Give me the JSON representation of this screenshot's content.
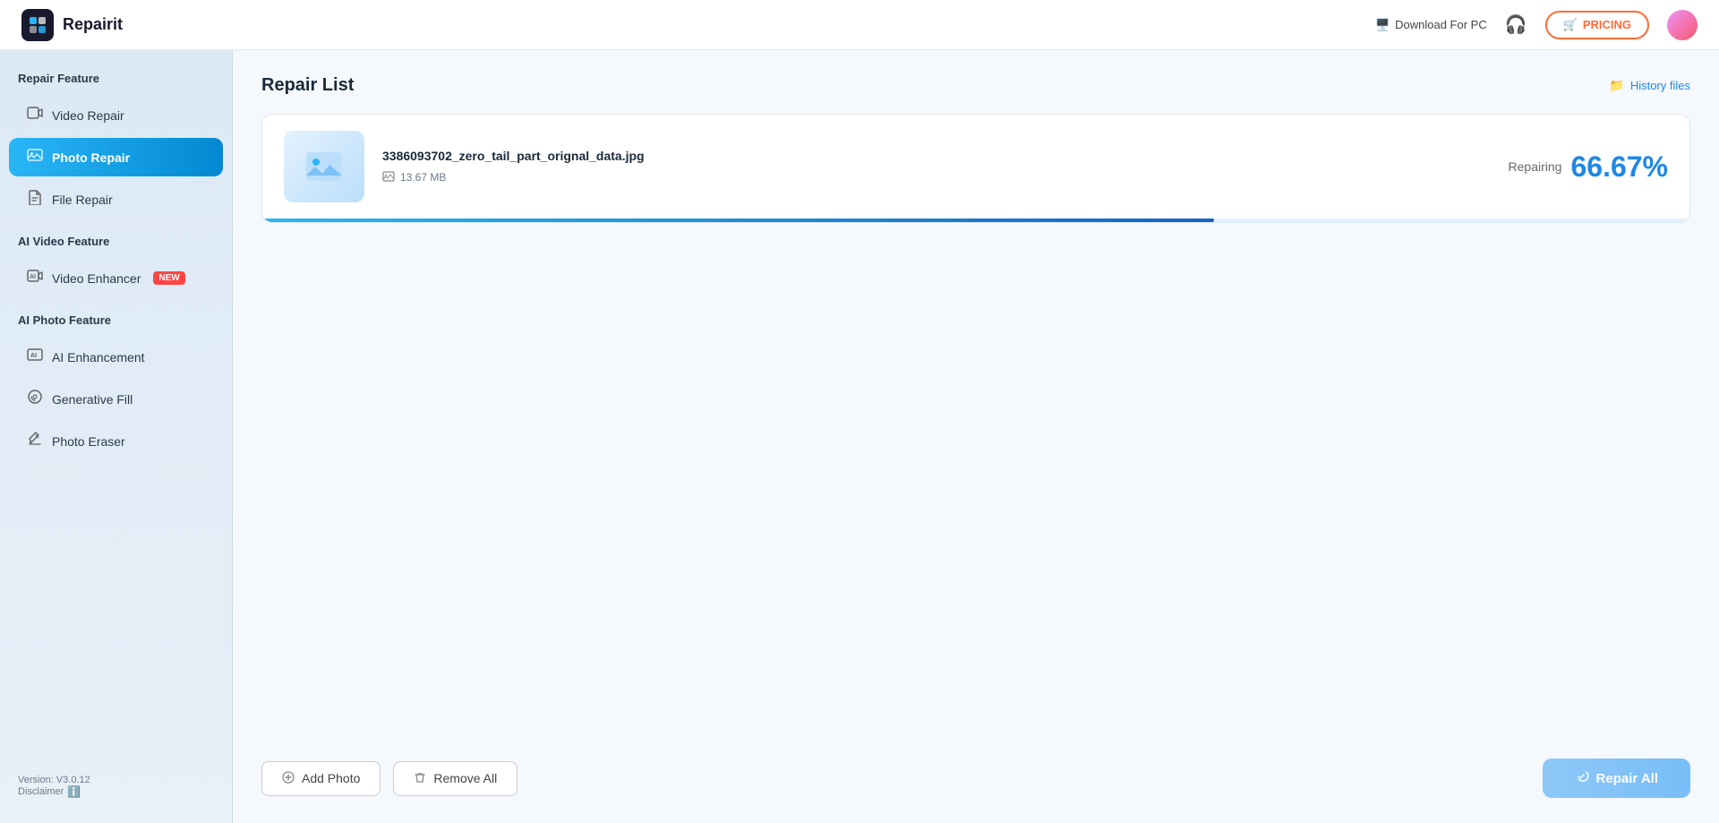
{
  "app": {
    "logo_text": "Repairit",
    "logo_emoji": "🔲"
  },
  "header": {
    "download_pc_label": "Download For PC",
    "pricing_label": "PRICING",
    "pricing_icon": "🛒"
  },
  "sidebar": {
    "repair_feature_title": "Repair Feature",
    "video_repair_label": "Video Repair",
    "photo_repair_label": "Photo Repair",
    "file_repair_label": "File Repair",
    "ai_video_feature_title": "AI Video Feature",
    "video_enhancer_label": "Video Enhancer",
    "video_enhancer_badge": "NEW",
    "ai_photo_feature_title": "AI Photo Feature",
    "ai_enhancement_label": "AI Enhancement",
    "generative_fill_label": "Generative Fill",
    "photo_eraser_label": "Photo Eraser",
    "version_label": "Version: V3.0.12",
    "disclaimer_label": "Disclaimer"
  },
  "content": {
    "repair_list_title": "Repair List",
    "history_files_label": "History files",
    "file": {
      "name": "3386093702_zero_tail_part_orignal_data.jpg",
      "size": "13.67 MB",
      "repairing_label": "Repairing",
      "percent": "66.67%",
      "progress": 66.67
    },
    "add_photo_label": "Add Photo",
    "remove_all_label": "Remove All",
    "repair_all_label": "Repair All"
  },
  "icons": {
    "monitor": "🖥️",
    "support": "🎧",
    "folder": "📁",
    "file_size": "🖼️",
    "add": "➕",
    "trash": "🗑️",
    "repair": "🔧"
  }
}
